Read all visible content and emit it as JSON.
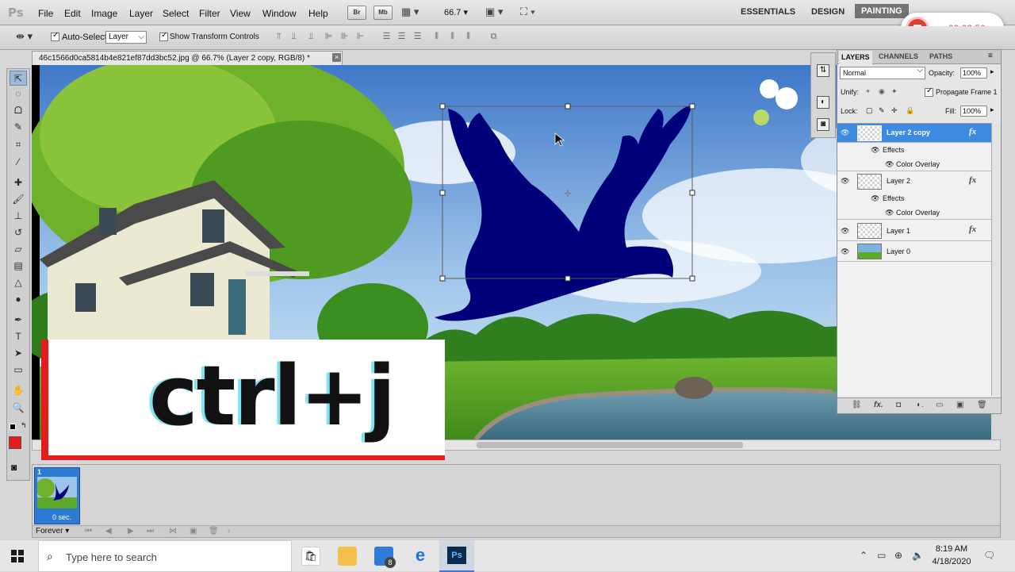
{
  "app": {
    "logo": "Ps"
  },
  "menubar": {
    "items": [
      "File",
      "Edit",
      "Image",
      "Layer",
      "Select",
      "Filter",
      "View",
      "Window",
      "Help"
    ],
    "bridge_label": "Br",
    "minibridge_label": "Mb",
    "zoom": "66.7",
    "workspaces": [
      "ESSENTIALS",
      "DESIGN",
      "PAINTING"
    ],
    "active_workspace": "PAINTING"
  },
  "recorder": {
    "time": "00:03:50"
  },
  "options": {
    "auto_select_label": "Auto-Select:",
    "auto_select_value": "Layer",
    "show_transform_label": "Show Transform Controls"
  },
  "document": {
    "tab_title": "46c1566d0ca5814b4e821ef87dd3bc52.jpg @ 66.7% (Layer 2 copy, RGB/8) *",
    "close": "×"
  },
  "overlay": {
    "text": "ctrl+j"
  },
  "animation": {
    "frame_number": "1",
    "frame_delay": "0 sec.",
    "loop": "Forever"
  },
  "layers_panel": {
    "tabs": [
      "LAYERS",
      "CHANNELS",
      "PATHS"
    ],
    "blend_mode": "Normal",
    "opacity_label": "Opacity:",
    "opacity": "100%",
    "unify_label": "Unify:",
    "propagate_label": "Propagate Frame 1",
    "lock_label": "Lock:",
    "fill_label": "Fill:",
    "fill": "100%",
    "rows": [
      {
        "name": "Layer 2 copy",
        "selected": true,
        "fx": true
      },
      {
        "name": "Effects",
        "sub": true
      },
      {
        "name": "Color Overlay",
        "sub2": true
      },
      {
        "name": "Layer 2",
        "fx": true
      },
      {
        "name": "Effects",
        "sub": true
      },
      {
        "name": "Color Overlay",
        "sub2": true
      },
      {
        "name": "Layer 1",
        "fx": true
      },
      {
        "name": "Layer 0"
      }
    ],
    "fx_label": "fx"
  },
  "taskbar": {
    "search_placeholder": "Type here to search",
    "mail_badge": "8",
    "ps_label": "Ps",
    "time": "8:19 AM",
    "date": "4/18/2020"
  },
  "colors": {
    "foreground": "#e41c1c",
    "dove": "#00007a",
    "selection": "#3d8be0"
  }
}
